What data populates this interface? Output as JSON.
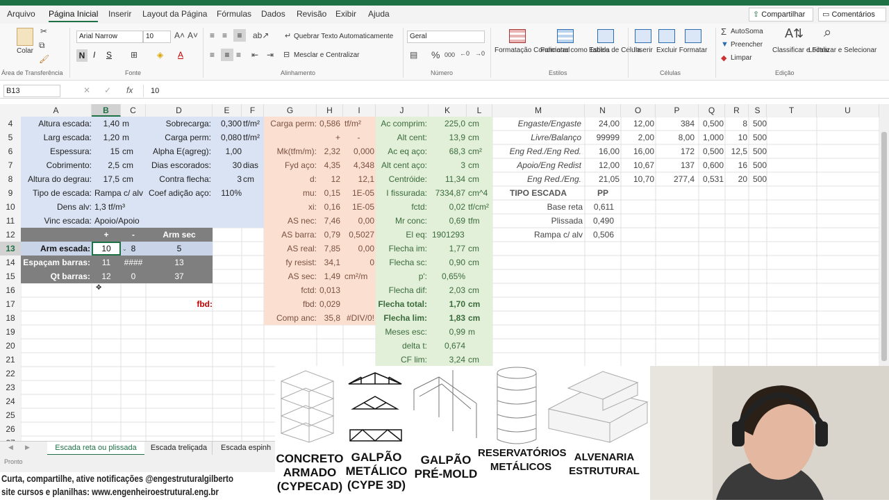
{
  "menu": {
    "tabs": [
      "Arquivo",
      "Página Inicial",
      "Inserir",
      "Layout da Página",
      "Fórmulas",
      "Dados",
      "Revisão",
      "Exibir",
      "Ajuda"
    ],
    "share": "Compartilhar",
    "comments": "Comentários"
  },
  "ribbon": {
    "paste": "Colar",
    "clipboard_group": "Área de Transferência",
    "font_name": "Arial Narrow",
    "font_size": "10",
    "bold": "N",
    "italic": "I",
    "underline": "S",
    "font_group": "Fonte",
    "wrap_text": "Quebrar Texto Automaticamente",
    "merge_center": "Mesclar e Centralizar",
    "alignment_group": "Alinhamento",
    "number_format": "Geral",
    "number_group": "Número",
    "cond_format": "Formatação Condicional",
    "format_table": "Formatar como Tabela",
    "cell_styles": "Estilos de Célula",
    "styles_group": "Estilos",
    "insert": "Inserir",
    "delete": "Excluir",
    "format": "Formatar",
    "cells_group": "Células",
    "autosum": "AutoSoma",
    "fill": "Preencher",
    "clear": "Limpar",
    "sort_filter": "Classificar e Filtrar",
    "find_select": "Localizar e Selecionar",
    "editing_group": "Edição"
  },
  "formula_bar": {
    "name_box": "B13",
    "fx": "fx",
    "value": "10"
  },
  "columns": [
    "A",
    "B",
    "C",
    "D",
    "E",
    "F",
    "G",
    "H",
    "I",
    "J",
    "K",
    "L",
    "M",
    "N",
    "O",
    "P",
    "Q",
    "R",
    "S",
    "T",
    "U"
  ],
  "rows": [
    "4",
    "5",
    "6",
    "7",
    "8",
    "9",
    "10",
    "11",
    "12",
    "13",
    "14",
    "15",
    "16",
    "17",
    "18",
    "19",
    "20",
    "21",
    "22",
    "23",
    "24",
    "25",
    "26",
    "27"
  ],
  "blockA": [
    [
      "Altura escada:",
      "1,40",
      "m",
      "Sobrecarga:",
      "0,300",
      "tf/m²"
    ],
    [
      "Larg escada:",
      "1,20",
      "m",
      "Carga perm:",
      "0,080",
      "tf/m²"
    ],
    [
      "Espessura:",
      "15",
      "cm",
      "Alpha E(agreg):",
      "1,00",
      ""
    ],
    [
      "Cobrimento:",
      "2,5",
      "cm",
      "Dias escorados:",
      "30",
      "dias"
    ],
    [
      "Altura do degrau:",
      "17,5",
      "cm",
      "Contra flecha:",
      "3",
      "cm"
    ],
    [
      "Tipo de escada:",
      "Rampa c/ alv",
      "",
      "Coef adição aço:",
      "110%",
      ""
    ],
    [
      "Dens alv:",
      "1,3 tf/m³",
      "",
      "",
      "",
      ""
    ],
    [
      "Vinc escada:",
      "Apoio/Apoio",
      "",
      "",
      "",
      ""
    ]
  ],
  "armTable": {
    "header": [
      "",
      "+",
      "-",
      "Arm sec"
    ],
    "rows": [
      [
        "Arm escada:",
        "10",
        "8",
        "5"
      ],
      [
        "Espaçam barras:",
        "11",
        "####",
        "13"
      ],
      [
        "Qt barras:",
        "12",
        "0",
        "37"
      ]
    ]
  },
  "fbd_label": "fbd:",
  "blockG": [
    [
      "Carga perm:",
      "0,586",
      "tf/m²"
    ],
    [
      "",
      "+",
      "-"
    ],
    [
      "Mk(tfm/m):",
      "2,32",
      "0,000"
    ],
    [
      "Fyd aço:",
      "4,35",
      "4,348"
    ],
    [
      "d:",
      "12",
      "12,1"
    ],
    [
      "mu:",
      "0,15",
      "1E-05"
    ],
    [
      "xi:",
      "0,16",
      "1E-05"
    ],
    [
      "AS nec:",
      "7,46",
      "0,00"
    ],
    [
      "AS barra:",
      "0,79",
      "0,5027"
    ],
    [
      "AS real:",
      "7,85",
      "0,00"
    ],
    [
      "fy resist:",
      "34,1",
      "0"
    ],
    [
      "AS sec:",
      "1,49",
      "cm²/m"
    ],
    [
      "fctd:",
      "0,013",
      ""
    ],
    [
      "fbd:",
      "0,029",
      ""
    ],
    [
      "Comp anc:",
      "35,8",
      "#DIV/0!"
    ]
  ],
  "blockJ": [
    [
      "Ac comprim:",
      "225,0",
      "cm"
    ],
    [
      "Alt cent:",
      "13,9",
      "cm"
    ],
    [
      "Ac eq aço:",
      "68,3",
      "cm²"
    ],
    [
      "Alt cent aço:",
      "3",
      "cm"
    ],
    [
      "Centróide:",
      "11,34",
      "cm"
    ],
    [
      "I fissurada:",
      "7334,87",
      "cm^4"
    ],
    [
      "fctd:",
      "0,02",
      "tf/cm²"
    ],
    [
      "Mr conc:",
      "0,69",
      "tfm"
    ],
    [
      "El eq:",
      "1901293",
      ""
    ],
    [
      "Flecha im:",
      "1,77",
      "cm"
    ],
    [
      "Flecha sc:",
      "0,90",
      "cm"
    ],
    [
      "p':",
      "0,65%",
      ""
    ],
    [
      "Flecha dif:",
      "2,03",
      "cm"
    ],
    [
      "Flecha total:",
      "1,70",
      "cm"
    ],
    [
      "Flecha lim:",
      "1,83",
      "cm"
    ],
    [
      "Meses esc:",
      "0,99",
      "m"
    ],
    [
      "delta t:",
      "0,674",
      ""
    ],
    [
      "CF lim:",
      "3,24",
      "cm"
    ]
  ],
  "blockM": [
    [
      "Engaste/Engaste",
      "24,00",
      "12,00",
      "384",
      "0,500",
      "8",
      "500"
    ],
    [
      "Livre/Balanço",
      "99999",
      "2,00",
      "8,00",
      "1,000",
      "10",
      "500"
    ],
    [
      "Eng Red./Eng Red.",
      "16,00",
      "16,00",
      "172",
      "0,500",
      "12,5",
      "500"
    ],
    [
      "Apoio/Eng Redist",
      "12,00",
      "10,67",
      "137",
      "0,600",
      "16",
      "500"
    ],
    [
      "Eng Red./Eng.",
      "21,05",
      "10,70",
      "277,4",
      "0,531",
      "20",
      "500"
    ]
  ],
  "tipo": {
    "title": "TIPO ESCADA",
    "pp": "PP",
    "rows": [
      [
        "Base reta",
        "0,611"
      ],
      [
        "Plissada",
        "0,490"
      ],
      [
        "Rampa c/ alv",
        "0,506"
      ]
    ]
  },
  "sheet_tabs": [
    "Escada reta ou plissada",
    "Escada treliçada",
    "Escada espinh"
  ],
  "status": "Pronto",
  "promo": {
    "line1": "Curta, compartilhe, ative notificações @engestruturalgilberto",
    "line2": "site cursos e planilhas: www.engenheiroestrutural.eng.br"
  },
  "cards": [
    {
      "label1": "CONCRETO",
      "label2": "ARMADO",
      "label3": "(CYPECAD)"
    },
    {
      "label1": "GALPÃO",
      "label2": "METÁLICO",
      "label3": "(CYPE 3D)"
    },
    {
      "label1": "GALPÃO",
      "label2": "PRÉ-MOLD",
      "label3": ""
    },
    {
      "label1": "RESERVATÓRIOS",
      "label2": "METÁLICOS",
      "label3": ""
    },
    {
      "label1": "ALVENARIA",
      "label2": "ESTRUTURAL",
      "label3": ""
    }
  ],
  "colors": {
    "blue": "#dae3f3",
    "salmon": "#fbe0d2",
    "green": "#e2efd9",
    "grey": "#7f7f7f",
    "header": "#f3f3f3",
    "accent": "#1e7145"
  }
}
